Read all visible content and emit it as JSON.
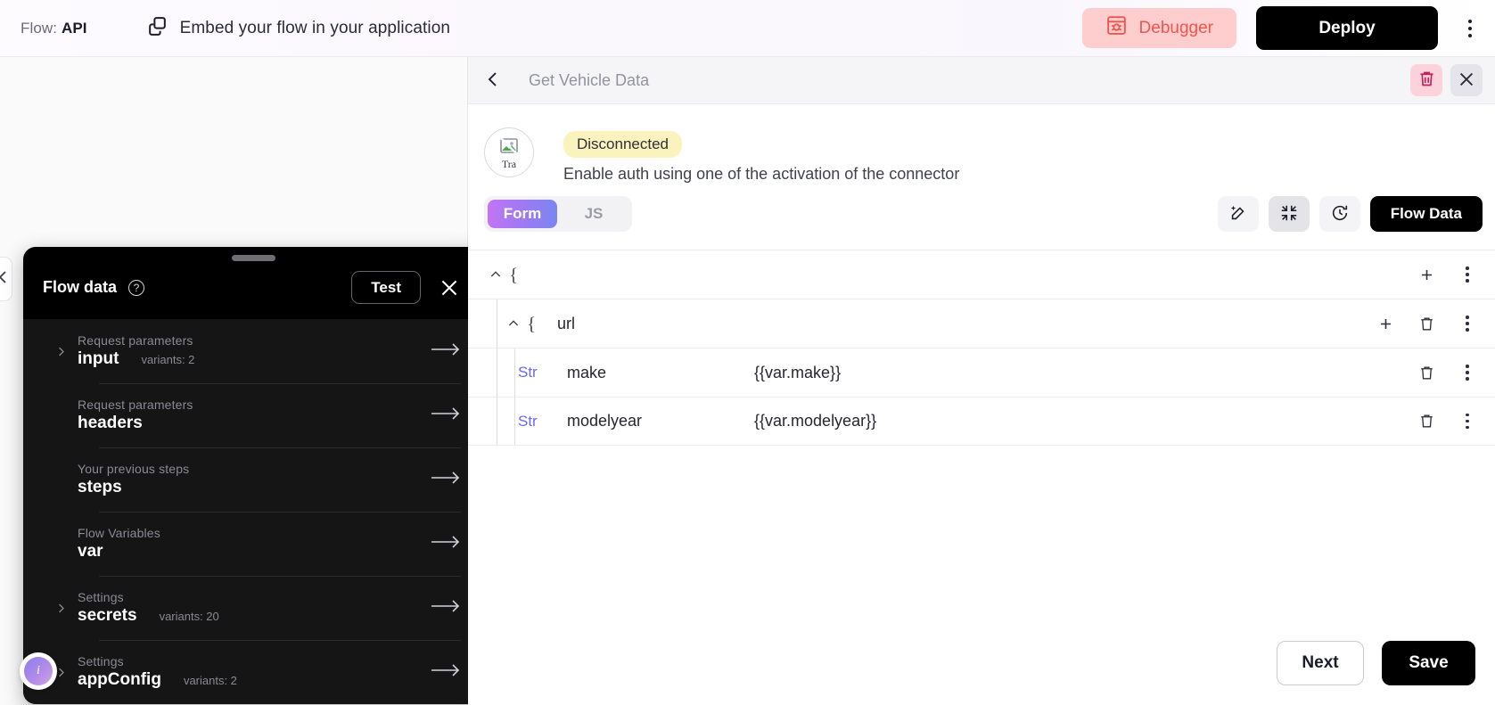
{
  "topbar": {
    "flow_prefix": "Flow:",
    "flow_name": "API",
    "embed_text": "Embed your flow in your application",
    "debugger_label": "Debugger",
    "deploy_label": "Deploy"
  },
  "flow_data_panel": {
    "title": "Flow data",
    "help_glyph": "?",
    "test_label": "Test",
    "items": [
      {
        "sub": "Request parameters",
        "name": "input",
        "variants": "variants: 2",
        "expandable": true
      },
      {
        "sub": "Request parameters",
        "name": "headers",
        "variants": "",
        "expandable": false
      },
      {
        "sub": "Your previous steps",
        "name": "steps",
        "variants": "",
        "expandable": false
      },
      {
        "sub": "Flow Variables",
        "name": "var",
        "variants": "",
        "expandable": false
      },
      {
        "sub": "Settings",
        "name": "secrets",
        "variants": "variants: 20",
        "expandable": true
      },
      {
        "sub": "Settings",
        "name": "appConfig",
        "variants": "variants: 2",
        "expandable": true
      }
    ]
  },
  "right_panel": {
    "title": "Get Vehicle Data",
    "connector": {
      "avatar_alt": "Tra",
      "status_badge": "Disconnected",
      "note": "Enable auth using one of the activation of the connector"
    },
    "tabs": [
      {
        "label": "Form",
        "active": true
      },
      {
        "label": "JS",
        "active": false
      }
    ],
    "flow_data_button": "Flow Data",
    "editor": {
      "root_brace": "{",
      "group": {
        "brace": "{",
        "key": "url"
      },
      "fields": [
        {
          "type": "Str",
          "key": "make",
          "value": "{{var.make}}"
        },
        {
          "type": "Str",
          "key": "modelyear",
          "value": "{{var.modelyear}}"
        }
      ]
    },
    "footer": {
      "next_label": "Next",
      "save_label": "Save"
    }
  },
  "colors": {
    "debugger_bg": "#fecdcd",
    "debugger_fg": "#f0554f",
    "badge_bg": "#fbf3bd",
    "accent_gradient_start": "#c175f5",
    "accent_gradient_end": "#7b86f0",
    "type_color": "#6a6af0",
    "delete_bg": "#fcd3dd"
  }
}
